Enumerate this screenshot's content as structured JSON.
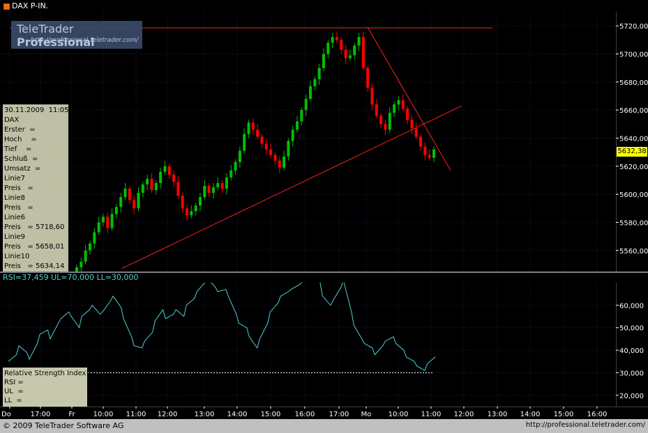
{
  "window": {
    "title": "DAX P-IN."
  },
  "logo": {
    "brand_light": "TeleTrader ",
    "brand_bold": "Professional",
    "url": "http://professional.teletrader.com/"
  },
  "info_box": {
    "rows": [
      "30.11.2009  11:05",
      "DAX",
      "Erster  =",
      "Hoch    =",
      "Tief    =",
      "Schluß  =",
      "Umsatz  =",
      "Linie7",
      "Preis   =",
      "Linie8",
      "Preis   =",
      "Linie6",
      "Preis   = 5718,60",
      "Linie9",
      "Preis   = 5658,01",
      "Linie10",
      "Preis   = 5634,14"
    ]
  },
  "rsi_header": "RSI=37,459  UL=70,000  LL=30,000",
  "rsi_box": {
    "rows": [
      "Relative Strength Index1",
      "RSI =",
      "UL  =",
      "LL  ="
    ]
  },
  "last_price": "5632,38",
  "price_axis": {
    "labels": [
      "5720,00",
      "5700,00",
      "5680,00",
      "5660,00",
      "5640,00",
      "5620,00",
      "5600,00",
      "5580,00",
      "5560,00"
    ]
  },
  "rsi_axis": {
    "labels": [
      "60,000",
      "50,000",
      "40,000",
      "30,000",
      "20,000"
    ]
  },
  "time_axis": {
    "labels": [
      "Do",
      "17:00",
      "Fr",
      "10:00",
      "11:00",
      "12:00",
      "13:00",
      "14:00",
      "15:00",
      "16:00",
      "17:00",
      "Mo",
      "10:00",
      "11:00",
      "12:00",
      "13:00",
      "14:00",
      "15:00",
      "16:00"
    ]
  },
  "footer": {
    "left": "© 2009 TeleTrader Software AG",
    "right": "http://professional.teletrader.com/"
  },
  "colors": {
    "up": "#00c000",
    "down": "#ff0000",
    "rsi": "#52cfd8",
    "trend": "#ff2020",
    "grid": "#1c1c3a"
  },
  "chart_data": [
    {
      "type": "candlestick",
      "title": "DAX P-IN.",
      "ylim": [
        5545,
        5728
      ],
      "annotations": [
        {
          "name": "Linie6",
          "type": "horizontal",
          "value": 5718.6
        },
        {
          "name": "Linie9",
          "type": "trendline",
          "value": 5658.01
        },
        {
          "name": "Linie10",
          "type": "trendline",
          "value": 5634.14
        }
      ],
      "last": 5632.38,
      "close": [
        5548,
        5552,
        5560,
        5565,
        5573,
        5580,
        5584,
        5576,
        5586,
        5591,
        5598,
        5604,
        5596,
        5590,
        5601,
        5607,
        5611,
        5603,
        5608,
        5616,
        5620,
        5614,
        5609,
        5599,
        5590,
        5585,
        5588,
        5592,
        5598,
        5606,
        5601,
        5605,
        5608,
        5604,
        5612,
        5617,
        5623,
        5631,
        5643,
        5651,
        5646,
        5641,
        5636,
        5632,
        5628,
        5624,
        5619,
        5627,
        5638,
        5646,
        5652,
        5660,
        5668,
        5677,
        5682,
        5690,
        5700,
        5708,
        5712,
        5710,
        5703,
        5697,
        5699,
        5706,
        5712,
        5690,
        5676,
        5664,
        5656,
        5650,
        5646,
        5658,
        5664,
        5667,
        5661,
        5653,
        5647,
        5641,
        5634,
        5628,
        5626,
        5632
      ]
    },
    {
      "type": "line",
      "series": [
        {
          "name": "RSI",
          "values": [
            35,
            38,
            42,
            39,
            36,
            43,
            47,
            49,
            45,
            52,
            54,
            57,
            55,
            50,
            55,
            58,
            60,
            56,
            57,
            62,
            64,
            59,
            54,
            46,
            42,
            41,
            44,
            48,
            53,
            58,
            54,
            56,
            58,
            55,
            60,
            63,
            66,
            70,
            72,
            68,
            66,
            67,
            64,
            56,
            52,
            50,
            46,
            41,
            45,
            52,
            57,
            61,
            64,
            66,
            67,
            69,
            70,
            71,
            72,
            70,
            64,
            60,
            62,
            68,
            71,
            57,
            51,
            45,
            43,
            41,
            38,
            42,
            44,
            46,
            43,
            40,
            37,
            35,
            33,
            31,
            34,
            37
          ]
        }
      ],
      "ylim": [
        15,
        70
      ],
      "reference_lines": [
        {
          "name": "UL",
          "value": 70
        },
        {
          "name": "LL",
          "value": 30
        }
      ]
    }
  ]
}
